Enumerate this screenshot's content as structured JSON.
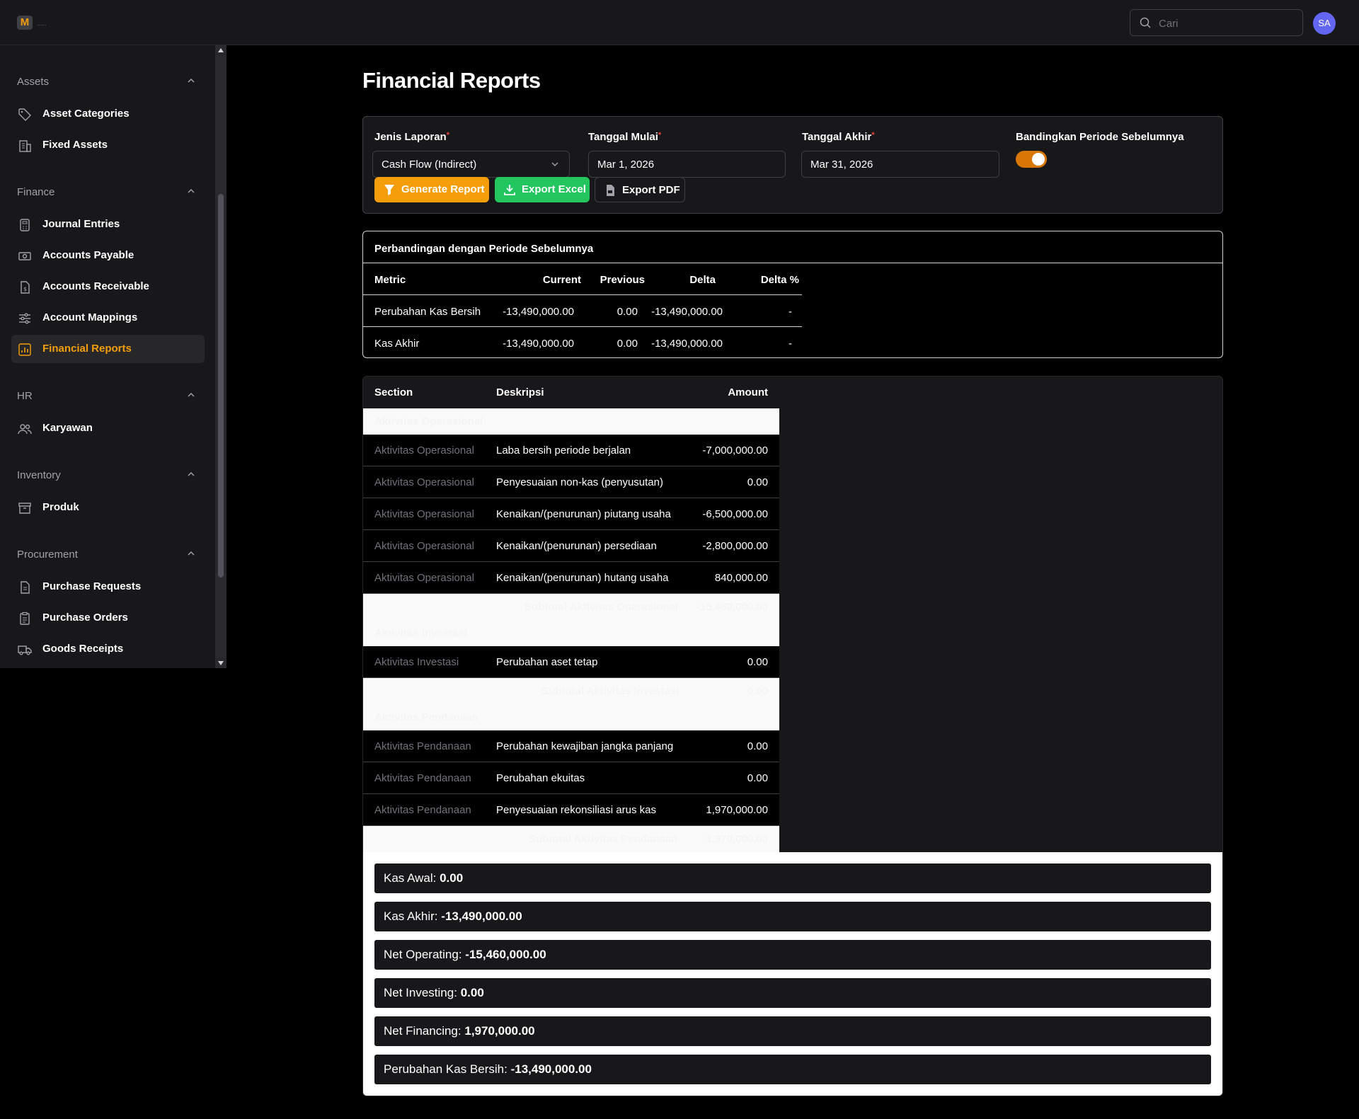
{
  "topbar": {
    "logo_letter": "M",
    "logo_text": "......",
    "search_placeholder": "Cari",
    "avatar_initials": "SA"
  },
  "sidebar": {
    "groups": [
      {
        "title": "Assets",
        "items": [
          {
            "label": "Asset Categories",
            "icon": "tag-icon"
          },
          {
            "label": "Fixed Assets",
            "icon": "building-icon"
          }
        ]
      },
      {
        "title": "Finance",
        "items": [
          {
            "label": "Journal Entries",
            "icon": "calculator-icon"
          },
          {
            "label": "Accounts Payable",
            "icon": "banknote-icon"
          },
          {
            "label": "Accounts Receivable",
            "icon": "receipt-icon"
          },
          {
            "label": "Account Mappings",
            "icon": "sliders-icon"
          },
          {
            "label": "Financial Reports",
            "icon": "chart-icon",
            "active": true
          }
        ]
      },
      {
        "title": "HR",
        "items": [
          {
            "label": "Karyawan",
            "icon": "users-icon"
          }
        ]
      },
      {
        "title": "Inventory",
        "items": [
          {
            "label": "Produk",
            "icon": "archive-icon"
          }
        ]
      },
      {
        "title": "Procurement",
        "items": [
          {
            "label": "Purchase Requests",
            "icon": "file-icon"
          },
          {
            "label": "Purchase Orders",
            "icon": "clipboard-icon"
          },
          {
            "label": "Goods Receipts",
            "icon": "truck-icon"
          }
        ]
      }
    ]
  },
  "page": {
    "title": "Financial Reports"
  },
  "filters": {
    "report_type_label": "Jenis Laporan",
    "report_type_value": "Cash Flow (Indirect)",
    "start_label": "Tanggal Mulai",
    "start_value": "Mar 1, 2026",
    "end_label": "Tanggal Akhir",
    "end_value": "Mar 31, 2026",
    "compare_label": "Bandingkan Periode Sebelumnya",
    "compare_enabled": true,
    "required_mark": "*",
    "generate_label": "Generate Report",
    "export_excel_label": "Export Excel",
    "export_pdf_label": "Export PDF"
  },
  "comparison": {
    "title": "Perbandingan dengan Periode Sebelumnya",
    "headers": [
      "Metric",
      "Current",
      "Previous",
      "Delta",
      "Delta %"
    ],
    "rows": [
      {
        "metric": "Perubahan Kas Bersih",
        "current": "-13,490,000.00",
        "previous": "0.00",
        "delta": "-13,490,000.00",
        "delta_pct": "-"
      },
      {
        "metric": "Kas Akhir",
        "current": "-13,490,000.00",
        "previous": "0.00",
        "delta": "-13,490,000.00",
        "delta_pct": "-"
      }
    ]
  },
  "report": {
    "headers": {
      "section": "Section",
      "description": "Deskripsi",
      "amount": "Amount"
    },
    "rows": [
      {
        "kind": "section",
        "section": "Aktivitas Operasional"
      },
      {
        "kind": "data",
        "section": "Aktivitas Operasional",
        "description": "Laba bersih periode berjalan",
        "amount": "-7,000,000.00"
      },
      {
        "kind": "data",
        "section": "Aktivitas Operasional",
        "description": "Penyesuaian non-kas (penyusutan)",
        "amount": "0.00"
      },
      {
        "kind": "data",
        "section": "Aktivitas Operasional",
        "description": "Kenaikan/(penurunan) piutang usaha",
        "amount": "-6,500,000.00"
      },
      {
        "kind": "data",
        "section": "Aktivitas Operasional",
        "description": "Kenaikan/(penurunan) persediaan",
        "amount": "-2,800,000.00"
      },
      {
        "kind": "data",
        "section": "Aktivitas Operasional",
        "description": "Kenaikan/(penurunan) hutang usaha",
        "amount": "840,000.00"
      },
      {
        "kind": "subtotal",
        "description": "Subtotal Aktivitas Operasional",
        "amount": "-15,460,000.00"
      },
      {
        "kind": "section",
        "section": "Aktivitas Investasi"
      },
      {
        "kind": "data",
        "section": "Aktivitas Investasi",
        "description": "Perubahan aset tetap",
        "amount": "0.00"
      },
      {
        "kind": "subtotal",
        "description": "Subtotal Aktivitas Investasi",
        "amount": "0.00"
      },
      {
        "kind": "section",
        "section": "Aktivitas Pendanaan"
      },
      {
        "kind": "data",
        "section": "Aktivitas Pendanaan",
        "description": "Perubahan kewajiban jangka panjang",
        "amount": "0.00"
      },
      {
        "kind": "data",
        "section": "Aktivitas Pendanaan",
        "description": "Perubahan ekuitas",
        "amount": "0.00"
      },
      {
        "kind": "data",
        "section": "Aktivitas Pendanaan",
        "description": "Penyesuaian rekonsiliasi arus kas",
        "amount": "1,970,000.00"
      },
      {
        "kind": "subtotal",
        "description": "Subtotal Aktivitas Pendanaan",
        "amount": "1,970,000.00"
      }
    ]
  },
  "summary": [
    {
      "label": "Kas Awal:",
      "value": "0.00"
    },
    {
      "label": "Kas Akhir:",
      "value": "-13,490,000.00"
    },
    {
      "label": "Net Operating:",
      "value": "-15,460,000.00"
    },
    {
      "label": "Net Investing:",
      "value": "0.00"
    },
    {
      "label": "Net Financing:",
      "value": "1,970,000.00"
    },
    {
      "label": "Perubahan Kas Bersih:",
      "value": "-13,490,000.00"
    }
  ],
  "colors": {
    "accent": "#f59e0b",
    "generate_button": "#f59e0b",
    "excel_button": "#22c55e",
    "toggle_on": "#d97706",
    "avatar": "#6366f1"
  }
}
